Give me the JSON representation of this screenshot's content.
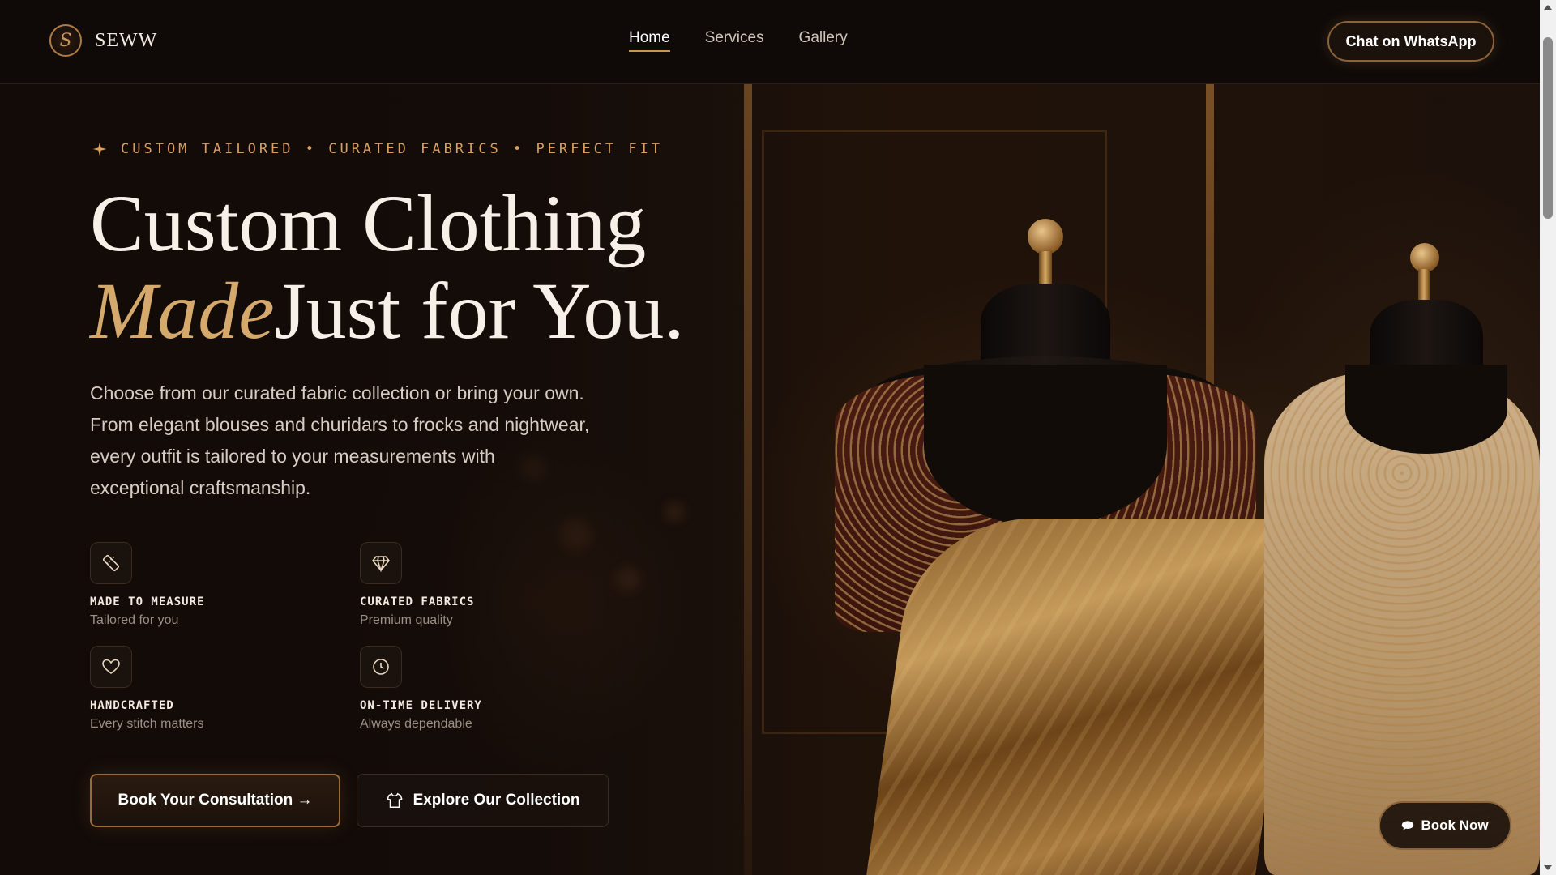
{
  "brand": {
    "logo_letter": "S",
    "name": "SEWW"
  },
  "nav": {
    "links": [
      {
        "label": "Home",
        "active": true
      },
      {
        "label": "Services",
        "active": false
      },
      {
        "label": "Gallery",
        "active": false
      }
    ],
    "cta_label": "Chat on WhatsApp"
  },
  "hero": {
    "tagline": "CUSTOM TAILORED • CURATED FABRICS • PERFECT FIT",
    "headline_line1": "Custom Clothing",
    "headline_accent": "Made",
    "headline_line2_rest": "Just for You.",
    "description": "Choose from our curated fabric collection or bring your own. From elegant blouses and churidars to frocks and nightwear, every outfit is tailored to your measurements with exceptional craftsmanship.",
    "features": [
      {
        "icon": "ruler-icon",
        "title": "MADE TO MEASURE",
        "subtitle": "Tailored for you"
      },
      {
        "icon": "diamond-icon",
        "title": "CURATED FABRICS",
        "subtitle": "Premium quality"
      },
      {
        "icon": "heart-icon",
        "title": "HANDCRAFTED",
        "subtitle": "Every stitch matters"
      },
      {
        "icon": "clock-icon",
        "title": "ON-TIME DELIVERY",
        "subtitle": "Always dependable"
      }
    ],
    "primary_cta": "Book Your Consultation →",
    "secondary_cta": "Explore Our Collection"
  },
  "floating_cta": {
    "label": "Book Now",
    "icon": "chat-bubble-icon"
  },
  "colors": {
    "accent": "#c99658",
    "background": "#120b08",
    "text": "#efe6dc"
  }
}
